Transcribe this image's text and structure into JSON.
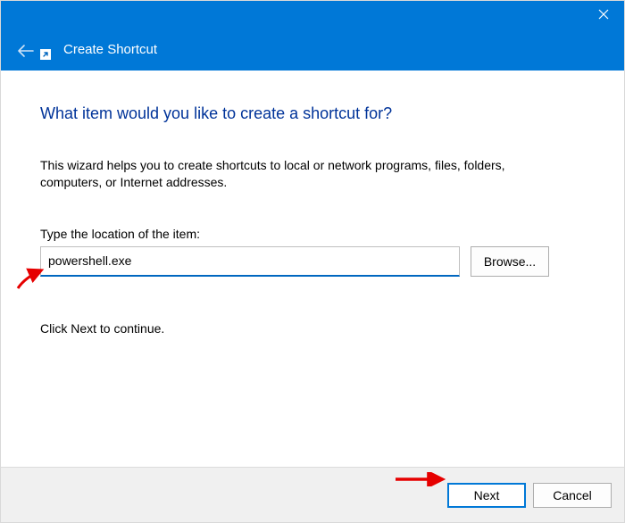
{
  "window": {
    "title": "Create Shortcut"
  },
  "page": {
    "heading": "What item would you like to create a shortcut for?",
    "description": "This wizard helps you to create shortcuts to local or network programs, files, folders, computers, or Internet addresses.",
    "field_label": "Type the location of the item:",
    "location_value": "powershell.exe",
    "browse_label": "Browse...",
    "continue_text": "Click Next to continue."
  },
  "footer": {
    "next_label": "Next",
    "cancel_label": "Cancel"
  }
}
